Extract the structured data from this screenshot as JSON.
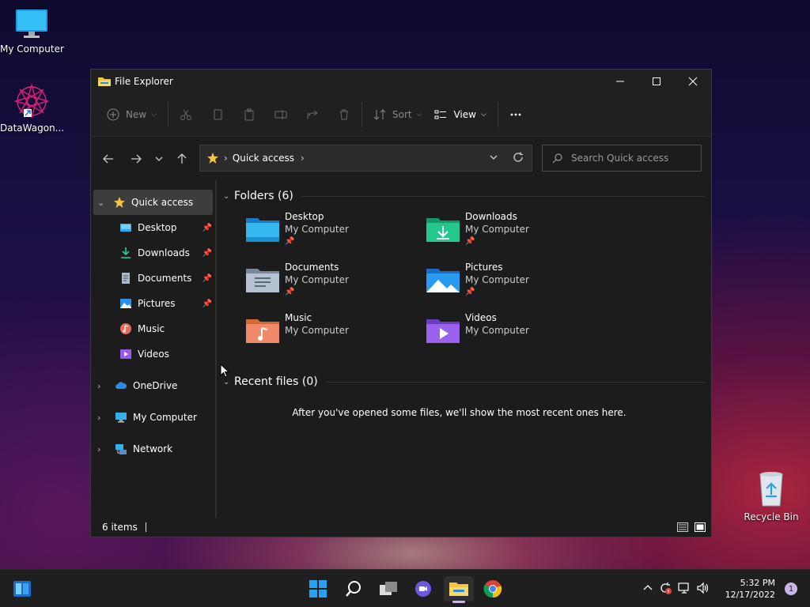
{
  "desktop": {
    "icons": [
      {
        "label": "My Computer"
      },
      {
        "label": "DataWagon..."
      },
      {
        "label": "Recycle Bin"
      }
    ]
  },
  "window": {
    "title": "File Explorer",
    "toolbar": {
      "new_label": "New",
      "sort_label": "Sort",
      "view_label": "View"
    },
    "address": {
      "crumb": "Quick access"
    },
    "search": {
      "placeholder": "Search Quick access"
    },
    "sidebar": {
      "items": [
        {
          "label": "Quick access",
          "icon": "star-icon"
        },
        {
          "label": "Desktop",
          "icon": "desktop-folder-icon"
        },
        {
          "label": "Downloads",
          "icon": "download-icon"
        },
        {
          "label": "Documents",
          "icon": "document-icon"
        },
        {
          "label": "Pictures",
          "icon": "pictures-icon"
        },
        {
          "label": "Music",
          "icon": "music-icon"
        },
        {
          "label": "Videos",
          "icon": "video-icon"
        },
        {
          "label": "OneDrive",
          "icon": "cloud-icon"
        },
        {
          "label": "My Computer",
          "icon": "computer-icon"
        },
        {
          "label": "Network",
          "icon": "network-icon"
        }
      ]
    },
    "folders_header": "Folders (6)",
    "folders": [
      {
        "name": "Desktop",
        "location": "My Computer"
      },
      {
        "name": "Downloads",
        "location": "My Computer"
      },
      {
        "name": "Documents",
        "location": "My Computer"
      },
      {
        "name": "Pictures",
        "location": "My Computer"
      },
      {
        "name": "Music",
        "location": "My Computer"
      },
      {
        "name": "Videos",
        "location": "My Computer"
      }
    ],
    "recent_header": "Recent files (0)",
    "recent_empty": "After you've opened some files, we'll show the most recent ones here.",
    "status": {
      "items_count": "6 items"
    }
  },
  "taskbar": {
    "time": "5:32 PM",
    "date": "12/17/2022",
    "notifications": "1"
  },
  "colors": {
    "accent_folder": "#f4c542",
    "window_bg": "#1c1c1c",
    "selected_nav": "#3d3d3d"
  }
}
